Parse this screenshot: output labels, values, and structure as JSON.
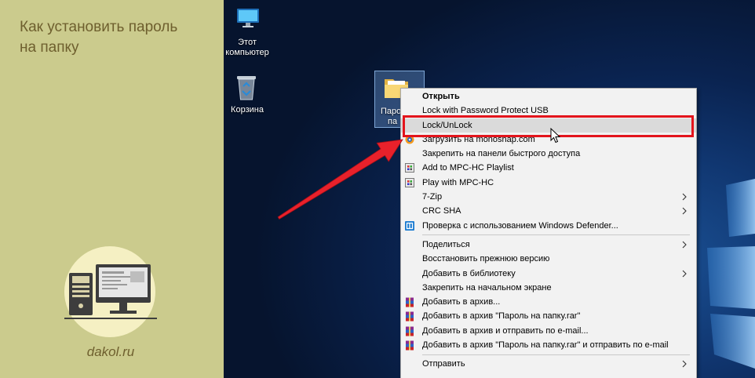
{
  "colors": {
    "panel-bg": "#cbcb8d",
    "panel-text": "#6e5f2e",
    "logo-bg": "#f5f0c3",
    "menu-bg": "#f2f2f2",
    "menu-hover": "#dadada",
    "annotation": "#e3141c"
  },
  "left_panel": {
    "title_lines": [
      "Как установить пароль",
      "на папку"
    ],
    "site": "dakol.ru",
    "logo_icon": "computer-illustration-icon"
  },
  "desktop": {
    "icons": [
      {
        "label_lines": [
          "Этот",
          "компьютер"
        ],
        "icon": "this-pc-icon"
      },
      {
        "label_lines": [
          "Корзина"
        ],
        "icon": "recycle-bin-icon"
      }
    ],
    "folder": {
      "label_lines": [
        "Паро",
        "па"
      ],
      "icon": "folder-icon",
      "selected": true
    }
  },
  "context_menu": {
    "items": [
      {
        "label": "Открыть",
        "default": true
      },
      {
        "label": "Lock with Password Protect USB"
      },
      {
        "label": "Lock/UnLock",
        "hovered": true
      },
      {
        "label": "Загрузить на monoshap.com",
        "icon": "monoshap-icon"
      },
      {
        "label": "Закрепить на панели быстрого доступа"
      },
      {
        "label": "Add to MPC-HC Playlist",
        "icon": "mpc-hc-icon"
      },
      {
        "label": "Play with MPC-HC",
        "icon": "mpc-hc-icon"
      },
      {
        "label": "7-Zip",
        "submenu": true
      },
      {
        "label": "CRC SHA",
        "submenu": true
      },
      {
        "label": "Проверка с использованием Windows Defender...",
        "icon": "windows-defender-icon"
      },
      {
        "label": "Поделиться",
        "submenu": true
      },
      {
        "label": "Восстановить прежнюю версию"
      },
      {
        "label": "Добавить в библиотеку",
        "submenu": true
      },
      {
        "label": "Закрепить на начальном экране"
      },
      {
        "label": "Добавить в архив...",
        "icon": "winrar-icon"
      },
      {
        "label": "Добавить в архив \"Пароль на папку.rar\"",
        "icon": "winrar-icon"
      },
      {
        "label": "Добавить в архив и отправить по e-mail...",
        "icon": "winrar-icon"
      },
      {
        "label": "Добавить в архив \"Пароль на папку.rar\" и отправить по e-mail",
        "icon": "winrar-icon"
      },
      {
        "label": "Отправить",
        "submenu": true
      }
    ]
  }
}
